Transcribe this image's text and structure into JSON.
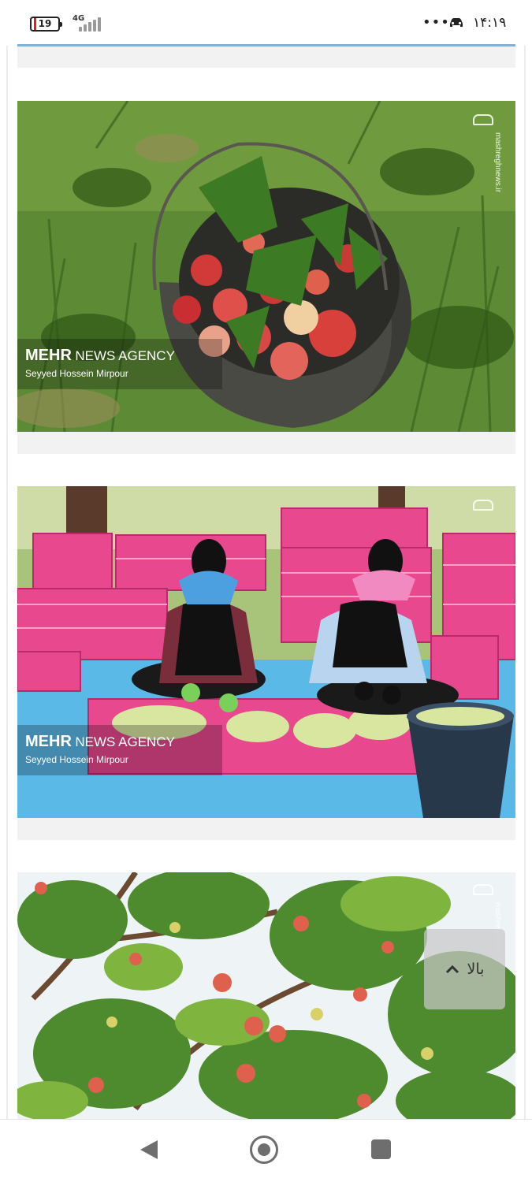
{
  "status_bar": {
    "battery": "19",
    "battery_fraction": 0.19,
    "network": "4G",
    "more": "•••",
    "time": "۱۴:۱۹"
  },
  "gallery": {
    "items": [
      {
        "subject": "bucket of red apples with leaves on grass",
        "watermark_brand": "MEHR",
        "watermark_agency": "NEWS AGENCY",
        "photographer": "Seyyed Hossein Mirpour",
        "side_site": "mashreghnews.ir"
      },
      {
        "subject": "two workers sorting green plums into pink crates",
        "watermark_brand": "MEHR",
        "watermark_agency": "NEWS AGENCY",
        "photographer": "Seyyed Hossein Mirpour",
        "side_site": ""
      },
      {
        "subject": "apple tree branches with fruit",
        "side_site": "mashreghnews.ir"
      }
    ]
  },
  "back_to_top": {
    "label": "بالا",
    "icon": "chevron-up-icon"
  },
  "nav_bar": {
    "back_icon": "back-triangle-icon",
    "home_icon": "home-circle-icon",
    "recents_icon": "recents-square-icon"
  },
  "colors": {
    "caption_bar": "#f2f2f2",
    "crate_pink": "#e8488e",
    "tarp_blue": "#54b8ea",
    "grass_green": "#4d7a2a"
  }
}
